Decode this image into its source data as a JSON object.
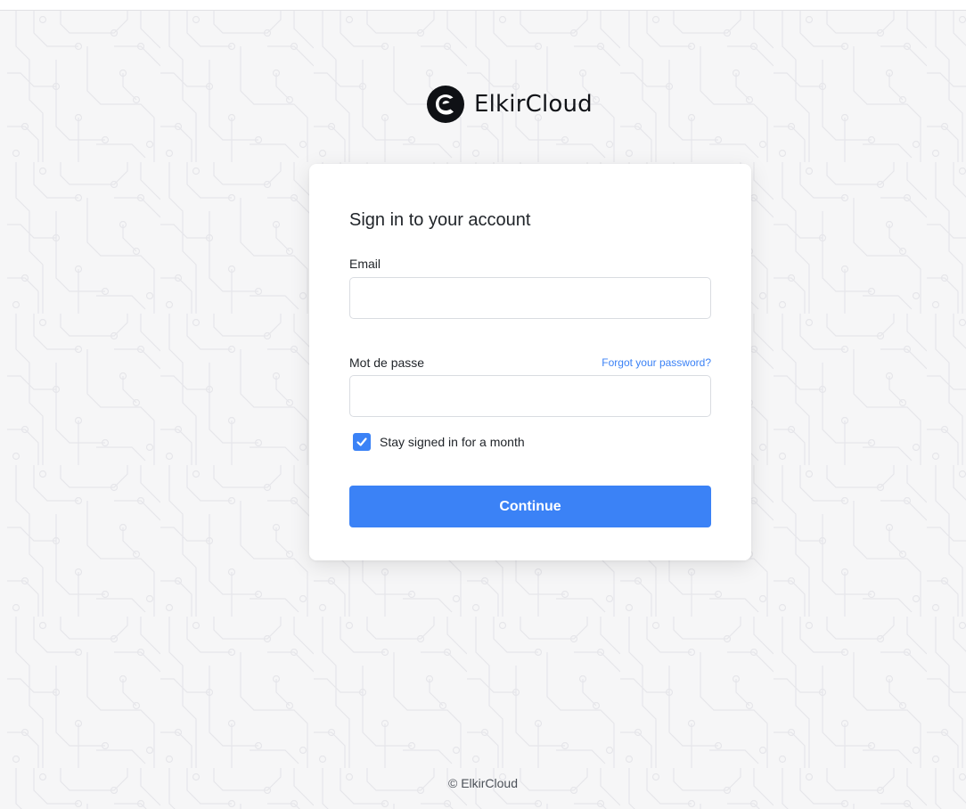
{
  "brand": {
    "name": "ElkirCloud",
    "logo_icon": "elkircloud-logo-icon"
  },
  "login": {
    "title": "Sign in to your account",
    "email_label": "Email",
    "email_value": "",
    "password_label": "Mot de passe",
    "password_value": "",
    "forgot_link": "Forgot your password?",
    "remember_label": "Stay signed in for a month",
    "remember_checked": true,
    "submit_label": "Continue"
  },
  "footer": {
    "copyright": "© ElkirCloud"
  },
  "colors": {
    "accent": "#3b82f6",
    "background": "#f6f6f7",
    "card": "#ffffff",
    "text": "#1f2328"
  }
}
